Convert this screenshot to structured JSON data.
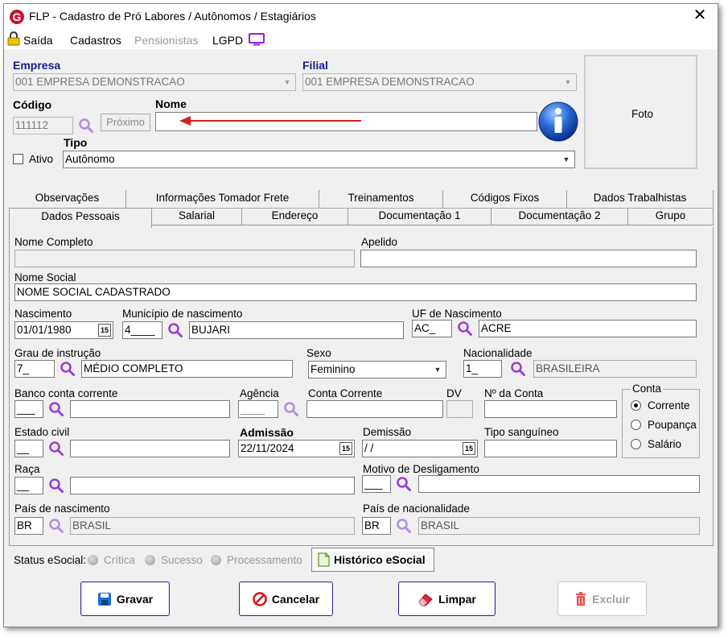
{
  "window": {
    "title": "FLP - Cadastro de Pró Labores / Autônomos / Estagiários",
    "close": "✕"
  },
  "menu": {
    "saida": "Saída",
    "cadastros": "Cadastros",
    "pensionistas": "Pensionistas",
    "lgpd": "LGPD"
  },
  "header": {
    "empresa_label": "Empresa",
    "empresa_value": "001 EMPRESA DEMONSTRACAO",
    "filial_label": "Filial",
    "filial_value": "001 EMPRESA DEMONSTRACAO",
    "codigo_label": "Código",
    "codigo_value": "111112",
    "proximo_label": "Próximo",
    "nome_label": "Nome",
    "nome_value": "",
    "ativo_label": "Ativo",
    "tipo_label": "Tipo",
    "tipo_value": "Autônomo",
    "foto_label": "Foto"
  },
  "tabs": {
    "row1": [
      "Observações",
      "Informações Tomador Frete",
      "Treinamentos",
      "Códigos Fixos",
      "Dados Trabalhistas"
    ],
    "row2": [
      "Dados Pessoais",
      "Salarial",
      "Endereço",
      "Documentação 1",
      "Documentação 2",
      "Grupo"
    ]
  },
  "form": {
    "nome_completo_label": "Nome Completo",
    "nome_completo_value": "",
    "apelido_label": "Apelido",
    "apelido_value": "",
    "nome_social_label": "Nome Social",
    "nome_social_value": "NOME SOCIAL CADASTRADO",
    "nascimento_label": "Nascimento",
    "nascimento_value": "01/01/1980",
    "municipio_label": "Município de nascimento",
    "municipio_code": "4____",
    "municipio_value": "BUJARI",
    "uf_label": "UF de Nascimento",
    "uf_code": "AC_",
    "uf_value": "ACRE",
    "grau_label": "Grau de instrução",
    "grau_code": "7_",
    "grau_value": "MÉDIO COMPLETO",
    "sexo_label": "Sexo",
    "sexo_value": "Feminino",
    "nacionalidade_label": "Nacionalidade",
    "nacionalidade_code": "1_",
    "nacionalidade_value": "BRASILEIRA",
    "banco_label": "Banco conta corrente",
    "banco_code": "___",
    "banco_value": "",
    "agencia_label": "Agência",
    "agencia_value": "____",
    "conta_corrente_label": "Conta Corrente",
    "conta_corrente_value": "",
    "dv_label": "DV",
    "dv_value": "",
    "num_conta_label": "Nº da Conta",
    "num_conta_value": "",
    "conta_group_label": "Conta",
    "conta_options": [
      "Corrente",
      "Poupança",
      "Salário"
    ],
    "conta_selected": "Corrente",
    "estado_civil_label": "Estado civil",
    "estado_civil_code": "__",
    "estado_civil_value": "",
    "admissao_label": "Admissão",
    "admissao_value": "22/11/2024",
    "demissao_label": "Demissão",
    "demissao_value": " / /",
    "tipo_sanguineo_label": "Tipo sanguíneo",
    "tipo_sanguineo_value": "",
    "raca_label": "Raça",
    "raca_code": "__",
    "raca_value": "",
    "motivo_label": "Motivo de Desligamento",
    "motivo_code": "___",
    "motivo_value": "",
    "pais_nasc_label": "País de nascimento",
    "pais_nasc_code": "BR",
    "pais_nasc_value": "BRASIL",
    "pais_nac_label": "País de nacionalidade",
    "pais_nac_code": "BR",
    "pais_nac_value": "BRASIL"
  },
  "status": {
    "label": "Status eSocial:",
    "critica": "Crítica",
    "sucesso": "Sucesso",
    "processamento": "Processamento",
    "historico": "Histórico eSocial"
  },
  "buttons": {
    "gravar": "Gravar",
    "cancelar": "Cancelar",
    "limpar": "Limpar",
    "excluir": "Excluir"
  },
  "calendar_glyph": "15",
  "colors": {
    "accent": "#1a1a8e",
    "logo": "#c8102e",
    "magnifier": "#9a3fd8",
    "arrow": "#d42020"
  }
}
